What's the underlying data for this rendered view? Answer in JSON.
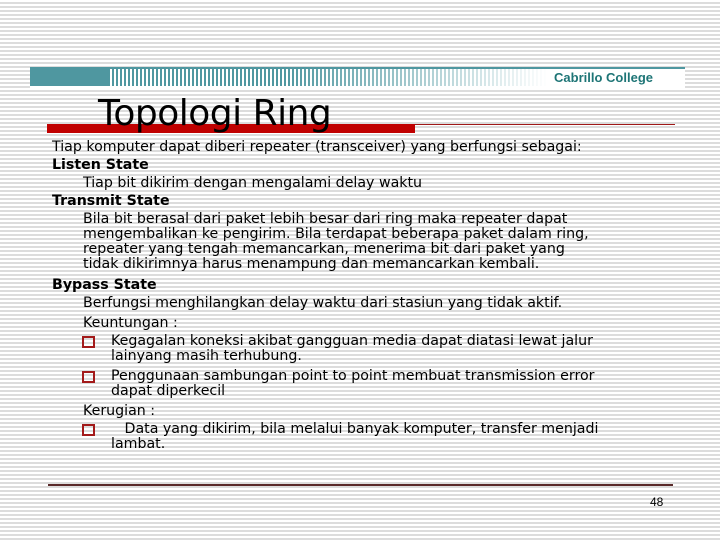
{
  "header": {
    "brand": "Cabrillo College",
    "accent_color": "#4f97a0",
    "brand_color": "#1e7576"
  },
  "slide": {
    "title": "Topologi Ring",
    "title_bar_color": "#c00000",
    "intro": "Tiap komputer dapat diberi repeater (transceiver) yang berfungsi sebagai:",
    "sections": [
      {
        "heading": "Listen State",
        "lines": [
          "Tiap bit dikirim dengan mengalami delay waktu"
        ]
      },
      {
        "heading": "Transmit State",
        "lines": [
          "Bila bit berasal dari paket lebih besar dari ring maka repeater dapat",
          "mengembalikan ke pengirim. Bila terdapat beberapa paket dalam ring,",
          "repeater yang tengah memancarkan, menerima bit dari paket yang",
          "tidak dikirimnya harus menampung dan memancarkan kembali."
        ]
      },
      {
        "heading": "Bypass State",
        "lines": [
          "Berfungsi menghilangkan delay waktu dari stasiun yang tidak aktif."
        ]
      }
    ],
    "advantages": {
      "label": "Keuntungan :",
      "items": [
        [
          "Kegagalan koneksi akibat gangguan media dapat diatasi lewat jalur",
          "lainyang masih terhubung."
        ],
        [
          "Penggunaan sambungan point to point membuat transmission error",
          "dapat diperkecil"
        ]
      ]
    },
    "disadvantages": {
      "label": "Kerugian :",
      "items": [
        [
          "   Data yang dikirim, bila melalui banyak komputer, transfer menjadi",
          "lambat."
        ]
      ]
    },
    "bullet_icon": "hollow-square-bullet",
    "bullet_color": "#a31a1a"
  },
  "footer": {
    "page_number": "48"
  }
}
